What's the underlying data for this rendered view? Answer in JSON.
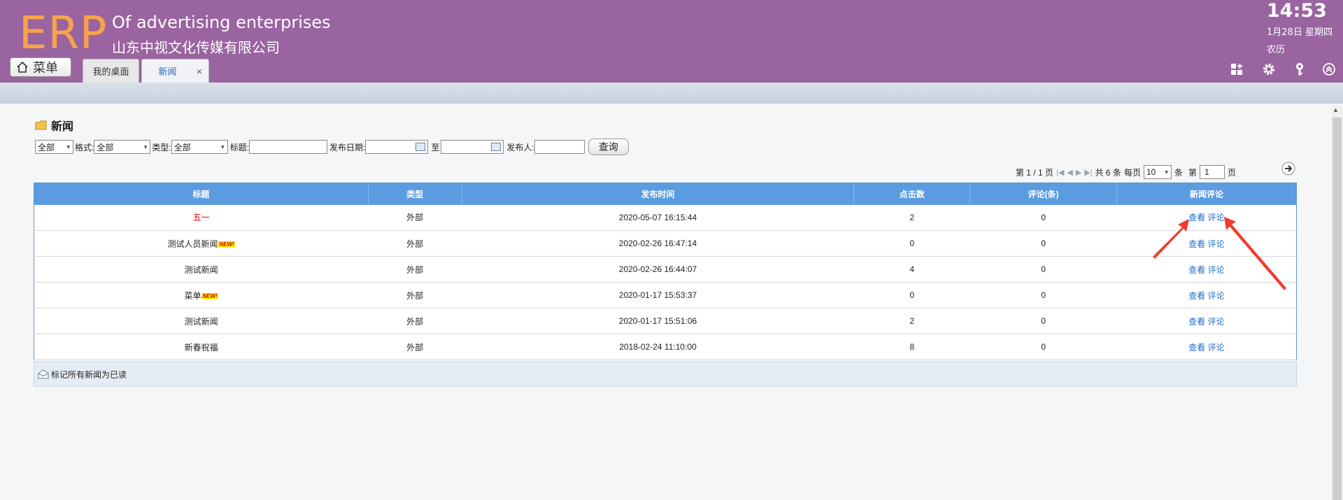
{
  "header": {
    "logo": "ERP",
    "subtitle_en": "Of advertising enterprises",
    "subtitle_cn": "山东中视文化传媒有限公司",
    "time": "14:53",
    "date": "1月28日 星期四",
    "lunar": "农历",
    "menu_label": "菜单",
    "tabs": [
      {
        "label": "我的桌面"
      },
      {
        "label": "新闻",
        "close": "×"
      }
    ],
    "icons": [
      "grid-plus-icon",
      "gear-icon",
      "key-icon",
      "collapse-up-icon"
    ]
  },
  "section": {
    "title": "新闻"
  },
  "filters": {
    "scope_value": "全部",
    "format_label": "格式:",
    "format_value": "全部",
    "type_label": "类型:",
    "type_value": "全部",
    "title_label": "标题:",
    "date_label": "发布日期:",
    "to_label": "至",
    "publisher_label": "发布人:",
    "query_button": "查询"
  },
  "pager": {
    "page_info": "第 1 / 1 页",
    "total": "共 6 条",
    "per_page_label": "每页",
    "per_page_value": "10",
    "unit": "条",
    "goto_label": "第",
    "goto_value": "1",
    "page_unit": "页"
  },
  "table": {
    "headers": [
      "标题",
      "类型",
      "发布时间",
      "点击数",
      "评论(条)",
      "新闻评论"
    ],
    "view_label": "查看",
    "comment_label": "评论",
    "new_badge": "NEW!",
    "rows": [
      {
        "title": "五一",
        "type": "外部",
        "time": "2020-05-07 16:15:44",
        "clicks": "2",
        "comments": "0"
      },
      {
        "title": "测试人员新闻",
        "type": "外部",
        "time": "2020-02-26 16:47:14",
        "clicks": "0",
        "comments": "0"
      },
      {
        "title": "测试新闻",
        "type": "外部",
        "time": "2020-02-26 16:44:07",
        "clicks": "4",
        "comments": "0"
      },
      {
        "title": "菜单",
        "type": "外部",
        "time": "2020-01-17 15:53:37",
        "clicks": "0",
        "comments": "0"
      },
      {
        "title": "测试新闻",
        "type": "外部",
        "time": "2020-01-17 15:51:06",
        "clicks": "2",
        "comments": "0"
      },
      {
        "title": "新春祝福",
        "type": "外部",
        "time": "2018-02-24 11:10:00",
        "clicks": "8",
        "comments": "0"
      }
    ]
  },
  "footer": {
    "mark_all_read": "标记所有新闻为已读"
  },
  "colors": {
    "header_bg": "#9a64a0",
    "logo": "#f6a44a",
    "table_header": "#5b9be0",
    "link": "#1f6fd1",
    "red_title": "#e00000",
    "arrow": "#f23a2e"
  }
}
